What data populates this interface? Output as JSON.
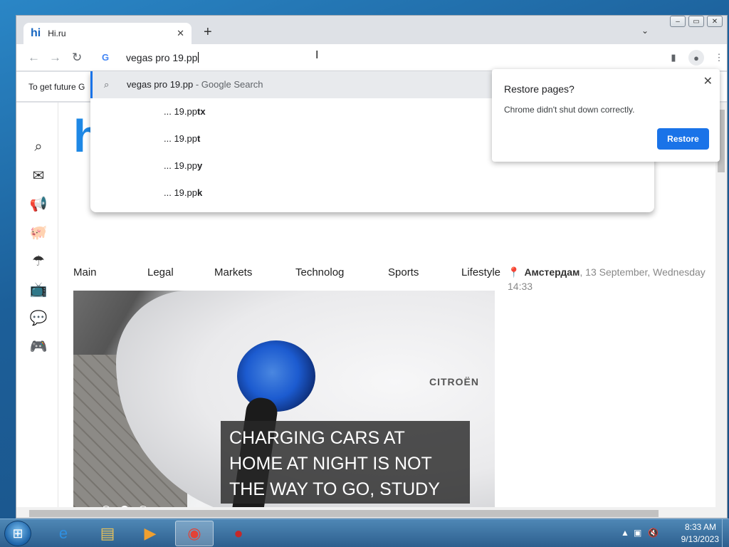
{
  "browser": {
    "tab_title": "Hi.ru",
    "tab_favicon": "hi",
    "address_text": "vegas pro 19.pp",
    "infobar_text": "To get future G",
    "window_controls": [
      "‒",
      "▭",
      "✕"
    ]
  },
  "suggestions": [
    {
      "prefix": "",
      "query": "vegas pro 19.pp",
      "suffix": " - Google Search",
      "bold": ""
    },
    {
      "prefix": "... 19.pp",
      "bold": "tx"
    },
    {
      "prefix": "... 19.pp",
      "bold": "t"
    },
    {
      "prefix": "... 19.pp",
      "bold": "y"
    },
    {
      "prefix": "... 19.pp",
      "bold": "k"
    }
  ],
  "restore_popup": {
    "title": "Restore pages?",
    "message": "Chrome didn't shut down correctly.",
    "button": "Restore"
  },
  "site": {
    "logo": "h",
    "categories": [
      "Main",
      "Legal",
      "Markets",
      "Technolog",
      "Sports",
      "Lifestyle"
    ],
    "hero_caption": "CHARGING CARS AT HOME AT NIGHT IS NOT THE WAY TO GO, STUDY FINDS",
    "hero_brand": "CITROËN",
    "weather_city": "Амстердам",
    "weather_date": ", 13 September, Wednesday",
    "weather_time": "14:33"
  },
  "taskbar": {
    "time": "8:33 AM",
    "date": "9/13/2023"
  },
  "colors": {
    "accent": "#1a73e8",
    "site_blue": "#1e88e5"
  }
}
